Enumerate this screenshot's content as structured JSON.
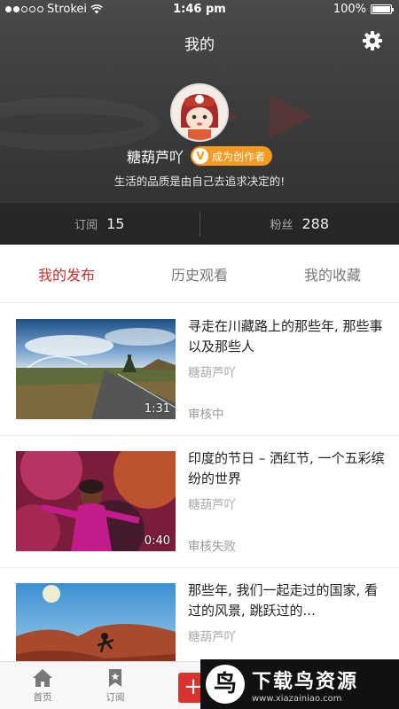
{
  "status_bar": {
    "carrier": "Strokei",
    "time": "1:46 pm",
    "battery": "100%",
    "battery_level": 1.0
  },
  "header": {
    "title": "我的",
    "settings_icon": "gear-icon"
  },
  "profile": {
    "username": "糖葫芦吖",
    "creator_badge_mark": "V",
    "creator_badge_label": "成为创作者",
    "motto": "生活的品质是由自己去追求决定的!",
    "stats": [
      {
        "label": "订阅",
        "value": "15"
      },
      {
        "label": "粉丝",
        "value": "288"
      }
    ]
  },
  "tabs": [
    {
      "label": "我的发布",
      "active": true
    },
    {
      "label": "历史观看",
      "active": false
    },
    {
      "label": "我的收藏",
      "active": false
    }
  ],
  "items": [
    {
      "title": "寻走在川藏路上的那些年, 那些事以及那些人",
      "author": "糖葫芦吖",
      "status": "审核中",
      "duration": "1:31"
    },
    {
      "title": "印度的节日 – 洒红节, 一个五彩缤纷的世界",
      "author": "糖葫芦吖",
      "status": "审核失败",
      "duration": "0:40"
    },
    {
      "title": "那些年, 我们一起走过的国家, 看过的风景, 跳跃过的...",
      "author": "糖葫芦吖",
      "status": "",
      "duration": ""
    }
  ],
  "bottom_nav": [
    {
      "label": "首页",
      "icon": "home-icon"
    },
    {
      "label": "订阅",
      "icon": "bookmark-icon"
    }
  ],
  "add_button_label": "+",
  "watermark": {
    "logo": "鸟",
    "title": "下载鸟资源",
    "url": "www.xiazainiao.com"
  },
  "colors": {
    "accent": "#c9302c",
    "badge": "#f39a1f"
  }
}
